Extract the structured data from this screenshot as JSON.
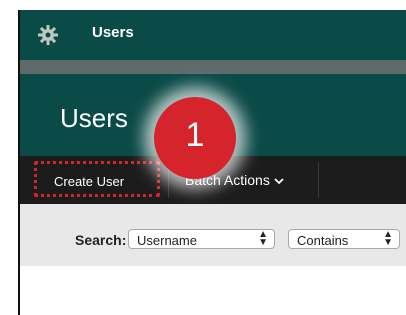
{
  "topbar": {
    "title": "Users",
    "icon": "gear-icon"
  },
  "header": {
    "title": "Users"
  },
  "step_badge": "1",
  "actions": {
    "create_user": "Create User",
    "batch_actions": "Batch Actions"
  },
  "search": {
    "label": "Search:",
    "field": "Username",
    "operator": "Contains"
  },
  "colors": {
    "brand_dark_teal": "#0a4a47",
    "highlight_red": "#d6242c",
    "action_bar": "#1c1c1c"
  }
}
